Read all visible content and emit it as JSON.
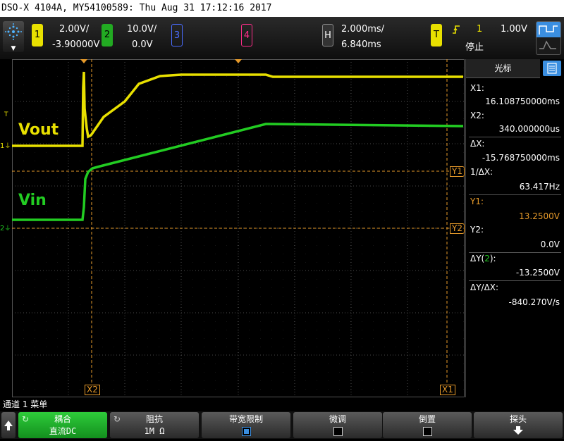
{
  "title": "DSO-X 4104A, MY54100589: Thu Aug 31 17:12:16 2017",
  "channels": [
    {
      "num": "1",
      "scale": "2.00V/",
      "offset": "-3.90000V",
      "color": "#e8e000"
    },
    {
      "num": "2",
      "scale": "10.0V/",
      "offset": "0.0V",
      "color": "#22cc22"
    },
    {
      "num": "3",
      "color": "#4a6cff"
    },
    {
      "num": "4",
      "color": "#ff2d8a"
    }
  ],
  "horizontal": {
    "key": "H",
    "scale": "2.000ms/",
    "delay": "6.840ms"
  },
  "trigger": {
    "key": "T",
    "source": "1",
    "level": "1.00V",
    "status": "停止"
  },
  "waveform_labels": {
    "vout": "Vout",
    "vin": "Vin"
  },
  "markers": {
    "ch1_ground": "1",
    "ch2_ground": "2",
    "trig_level": "T",
    "y1": "Y1",
    "y2": "Y2",
    "x1": "X1",
    "x2": "X2"
  },
  "cursor_panel": {
    "tab": "光标",
    "x1_label": "X1:",
    "x1_value": "16.108750000ms",
    "x2_label": "X2:",
    "x2_value": "340.000000us",
    "dx_label": "ΔX:",
    "dx_value": "-15.768750000ms",
    "inv_dx_label": "1/ΔX:",
    "inv_dx_value": "63.417Hz",
    "y1_label": "Y1:",
    "y1_value": "13.2500V",
    "y2_label": "Y2:",
    "y2_value": "0.0V",
    "dy_label_pre": "ΔY(",
    "dy_label_num": "2",
    "dy_label_post": "):",
    "dy_value": "-13.2500V",
    "dydx_label": "ΔY/ΔX:",
    "dydx_value": "-840.270V/s"
  },
  "menu_title": "通道 1 菜单",
  "softkeys": [
    {
      "label": "耦合",
      "value": "直流DC",
      "active": true
    },
    {
      "label": "阻抗",
      "value": "1M Ω"
    },
    {
      "label": "带宽限制"
    },
    {
      "label": "微调"
    },
    {
      "label": "倒置"
    },
    {
      "label": "探头"
    }
  ],
  "icons": {
    "logo": "keysight-logo-icon",
    "cursor_mode": "cursor-mode-icon",
    "edge": "rising-edge-icon",
    "menu": "menu-list-icon",
    "back": "up-arrow-icon",
    "probe_down": "down-arrow-icon"
  }
}
